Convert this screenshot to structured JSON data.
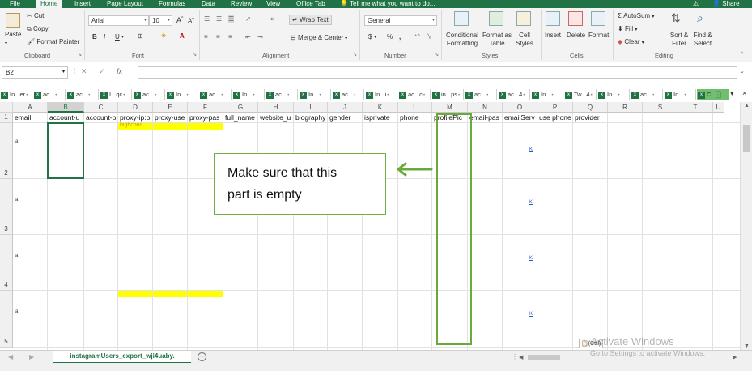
{
  "menu": {
    "tabs": [
      "File",
      "Home",
      "Insert",
      "Page Layout",
      "Formulas",
      "Data",
      "Review",
      "View",
      "Office Tab"
    ],
    "active": "Home",
    "tell_me": "Tell me what you want to do...",
    "share": "Share"
  },
  "ribbon": {
    "clipboard": {
      "label": "Clipboard",
      "paste": "Paste",
      "cut": "Cut",
      "copy": "Copy",
      "format_painter": "Format Painter"
    },
    "font": {
      "label": "Font",
      "name": "Arial",
      "size": "10",
      "grow": "A",
      "shrink": "A",
      "bold": "B",
      "italic": "I",
      "underline": "U"
    },
    "alignment": {
      "label": "Alignment",
      "wrap_text": "Wrap Text",
      "merge_center": "Merge & Center"
    },
    "number": {
      "label": "Number",
      "format": "General",
      "currency": "$",
      "percent": "%",
      "comma": ","
    },
    "styles": {
      "label": "Styles",
      "conditional": "Conditional Formatting",
      "format_table": "Format as Table",
      "cell_styles": "Cell Styles"
    },
    "cells": {
      "label": "Cells",
      "insert": "Insert",
      "delete": "Delete",
      "format": "Format"
    },
    "editing": {
      "label": "Editing",
      "autosum": "AutoSum",
      "fill": "Fill",
      "clear": "Clear",
      "sort_filter": "Sort & Filter",
      "find_select": "Find & Select"
    }
  },
  "formula_bar": {
    "name_box": "B2",
    "fx": "fx",
    "value": ""
  },
  "workbook_tabs": [
    "In...er",
    "ac...",
    "ac...",
    "I...qc",
    "ac...",
    "In...",
    "ac...",
    "In...",
    "ac...",
    "In...",
    "ac...",
    "In...i",
    "ac...c",
    "in...ps",
    "ac...",
    "ac...4",
    "In...",
    "Tw...4",
    "In...",
    "ac...",
    "In...",
    "C..."
  ],
  "columns": [
    "A",
    "B",
    "C",
    "D",
    "E",
    "F",
    "G",
    "H",
    "I",
    "J",
    "K",
    "L",
    "M",
    "N",
    "O",
    "P",
    "Q",
    "R",
    "S",
    "T",
    "U"
  ],
  "selected_column": "B",
  "rows": [
    "1",
    "2",
    "3",
    "4",
    "5"
  ],
  "header_row": [
    "email",
    "account-u",
    "account-p",
    "proxy-ip:p",
    "proxy-use",
    "proxy-pas",
    "full_name",
    "website_u",
    "biography",
    "gender",
    "isprivate",
    "phone",
    "profilePic",
    "email-pas",
    "emailServ",
    "use phone",
    "provider"
  ],
  "cell_snippets": {
    "d2_top": "highconc",
    "row_marker": "a",
    "link_marker": "K"
  },
  "callout": {
    "line1": "Make sure that this",
    "line2": "part is empty"
  },
  "sheet": {
    "name": "instagramUsers_export_wji4uaby.",
    "add": "+"
  },
  "ctrl_badge": "(Ctrl)",
  "watermark": {
    "title": "Activate Windows",
    "subtitle": "Go to Settings to activate Windows."
  },
  "colors": {
    "excel_green": "#217346",
    "highlight_yellow": "#ffff00",
    "callout_border": "#70ad47",
    "arrow_green": "#6aaa3a"
  }
}
